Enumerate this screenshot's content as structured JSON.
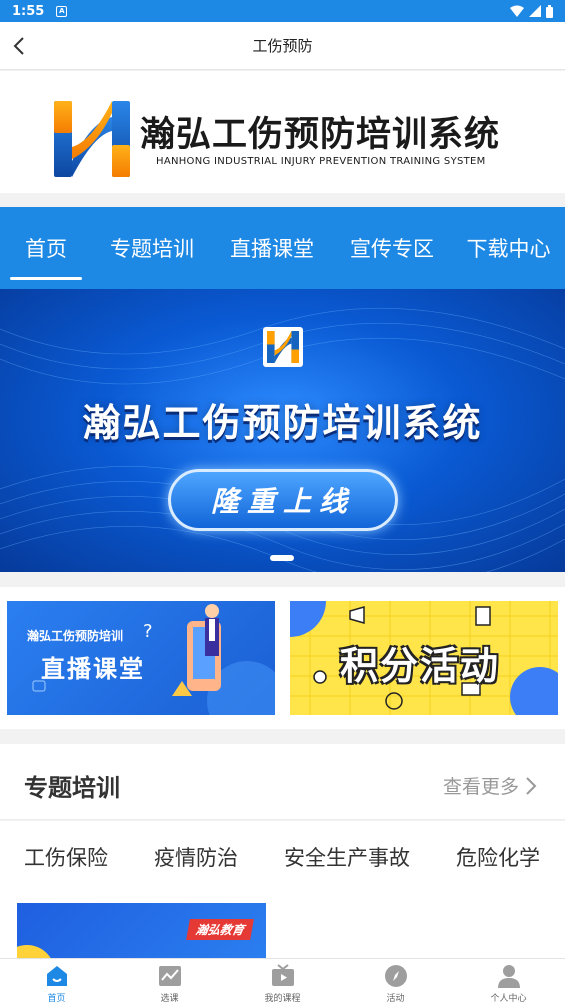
{
  "status_bar": {
    "time": "1:55",
    "notification_glyph": "A"
  },
  "navbar": {
    "title": "工伤预防"
  },
  "logo": {
    "title_cn": "瀚弘工伤预防培训系统",
    "title_en": "HANHONG INDUSTRIAL INJURY PREVENTION TRAINING SYSTEM"
  },
  "tabs": [
    {
      "label": "首页",
      "active": true
    },
    {
      "label": "专题培训",
      "active": false
    },
    {
      "label": "直播课堂",
      "active": false
    },
    {
      "label": "宣传专区",
      "active": false
    },
    {
      "label": "下载中心",
      "active": false
    }
  ],
  "banner": {
    "title": "瀚弘工伤预防培训系统",
    "pill": "隆重上线"
  },
  "promo_cards": {
    "live": {
      "small": "瀚弘工伤预防培训",
      "big": "直播课堂"
    },
    "points": {
      "big": "积分活动"
    }
  },
  "section": {
    "title": "专题培训",
    "more": "查看更多"
  },
  "categories": [
    "工伤保险",
    "疫情防治",
    "安全生产事故",
    "危险化学"
  ],
  "course": {
    "badge": "瀚弘教育"
  },
  "bottom_nav": [
    {
      "label": "首页",
      "icon": "home-icon",
      "active": true
    },
    {
      "label": "选课",
      "icon": "chart-icon",
      "active": false
    },
    {
      "label": "我的课程",
      "icon": "video-icon",
      "active": false
    },
    {
      "label": "活动",
      "icon": "compass-icon",
      "active": false
    },
    {
      "label": "个人中心",
      "icon": "user-icon",
      "active": false
    }
  ],
  "colors": {
    "primary": "#1e88e5",
    "accent_yellow": "#ffe44a",
    "badge_red": "#e53935"
  }
}
